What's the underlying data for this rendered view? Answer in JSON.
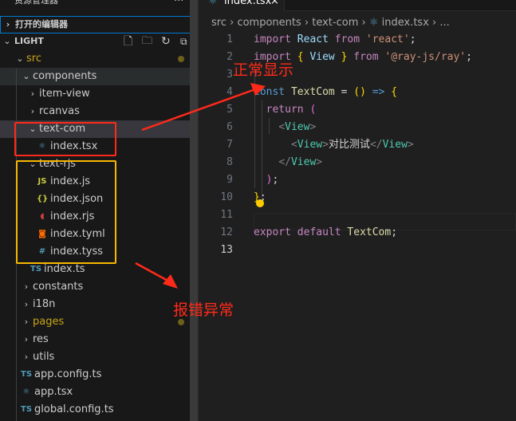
{
  "sidebar": {
    "title": "资源管理器",
    "more": "···",
    "open_editors": "打开的编辑器",
    "workspace": "LIGHT",
    "tree": [
      {
        "label": "src",
        "type": "folder",
        "open": true,
        "depth": 0,
        "modified": true,
        "color": "#c8a415"
      },
      {
        "label": "components",
        "type": "folder",
        "open": true,
        "depth": 1
      },
      {
        "label": "item-view",
        "type": "folder",
        "open": false,
        "depth": 2
      },
      {
        "label": "rcanvas",
        "type": "folder",
        "open": false,
        "depth": 2
      },
      {
        "label": "text-com",
        "type": "folder",
        "open": true,
        "depth": 2,
        "selected": true
      },
      {
        "label": "index.tsx",
        "type": "file",
        "icon": "react-icon",
        "depth": 3
      },
      {
        "label": "text-rjs",
        "type": "folder",
        "open": true,
        "depth": 2
      },
      {
        "label": "index.js",
        "type": "file",
        "icon": "js-icon",
        "depth": 3
      },
      {
        "label": "index.json",
        "type": "file",
        "icon": "json-icon",
        "depth": 3
      },
      {
        "label": "index.rjs",
        "type": "file",
        "icon": "rjs-icon",
        "depth": 3
      },
      {
        "label": "index.tyml",
        "type": "file",
        "icon": "tyml-icon",
        "depth": 3
      },
      {
        "label": "index.tyss",
        "type": "file",
        "icon": "hash-icon",
        "depth": 3
      },
      {
        "label": "index.ts",
        "type": "file",
        "icon": "ts-icon",
        "depth": 2
      },
      {
        "label": "constants",
        "type": "folder",
        "open": false,
        "depth": 1
      },
      {
        "label": "i18n",
        "type": "folder",
        "open": false,
        "depth": 1
      },
      {
        "label": "pages",
        "type": "folder",
        "open": false,
        "depth": 1,
        "modified": true,
        "color": "#c8a415"
      },
      {
        "label": "res",
        "type": "folder",
        "open": false,
        "depth": 1
      },
      {
        "label": "utils",
        "type": "folder",
        "open": false,
        "depth": 1
      },
      {
        "label": "app.config.ts",
        "type": "file",
        "icon": "ts-icon",
        "depth": 0.5
      },
      {
        "label": "app.tsx",
        "type": "file",
        "icon": "react-icon",
        "depth": 0.5
      },
      {
        "label": "global.config.ts",
        "type": "file",
        "icon": "ts-icon",
        "depth": 0.5
      }
    ]
  },
  "editor": {
    "tab": {
      "label": "index.tsx",
      "close": "×"
    },
    "breadcrumb": [
      "src",
      "components",
      "text-com",
      "index.tsx",
      "..."
    ],
    "lines": [
      [
        [
          "import",
          "k"
        ],
        [
          " ",
          "w"
        ],
        [
          "React",
          "v"
        ],
        [
          " ",
          "w"
        ],
        [
          "from",
          "k"
        ],
        [
          " ",
          "w"
        ],
        [
          "'react'",
          "s"
        ],
        [
          ";",
          "w"
        ]
      ],
      [
        [
          "import",
          "k"
        ],
        [
          " ",
          "w"
        ],
        [
          "{",
          "y"
        ],
        [
          " ",
          "w"
        ],
        [
          "View",
          "v"
        ],
        [
          " ",
          "w"
        ],
        [
          "}",
          "y"
        ],
        [
          " ",
          "w"
        ],
        [
          "from",
          "k"
        ],
        [
          " ",
          "w"
        ],
        [
          "'@ray-js/ray'",
          "s"
        ],
        [
          ";",
          "w"
        ]
      ],
      [],
      [
        [
          "const",
          "c"
        ],
        [
          " ",
          "w"
        ],
        [
          "TextCom",
          "f"
        ],
        [
          " = ",
          "w"
        ],
        [
          "()",
          "y"
        ],
        [
          " ",
          "w"
        ],
        [
          "=>",
          "c"
        ],
        [
          " ",
          "w"
        ],
        [
          "{",
          "y"
        ]
      ],
      [
        [
          "  ",
          "w"
        ],
        [
          "return",
          "k"
        ],
        [
          " ",
          "w"
        ],
        [
          "(",
          "p"
        ]
      ],
      [
        [
          "    ",
          "w"
        ],
        [
          "<",
          "g"
        ],
        [
          "View",
          "t"
        ],
        [
          ">",
          "g"
        ]
      ],
      [
        [
          "      ",
          "w"
        ],
        [
          "<",
          "g"
        ],
        [
          "View",
          "t"
        ],
        [
          ">",
          "g"
        ],
        [
          "对比测试",
          "w"
        ],
        [
          "</",
          "g"
        ],
        [
          "View",
          "t"
        ],
        [
          ">",
          "g"
        ]
      ],
      [
        [
          "    ",
          "w"
        ],
        [
          "</",
          "g"
        ],
        [
          "View",
          "t"
        ],
        [
          ">",
          "g"
        ]
      ],
      [
        [
          "  ",
          "w"
        ],
        [
          ")",
          "p"
        ],
        [
          ";",
          "w"
        ]
      ],
      [
        [
          "}",
          "y"
        ],
        [
          ";",
          "w"
        ]
      ],
      [],
      [
        [
          "export",
          "k"
        ],
        [
          " ",
          "w"
        ],
        [
          "default",
          "k"
        ],
        [
          " ",
          "w"
        ],
        [
          "TextCom",
          "f"
        ],
        [
          ";",
          "w"
        ]
      ],
      []
    ],
    "current_line": 13
  },
  "annotations": {
    "normal": "正常显示",
    "error": "报错异常",
    "red": "#ff2a1a",
    "yellow": "#f5b800"
  }
}
